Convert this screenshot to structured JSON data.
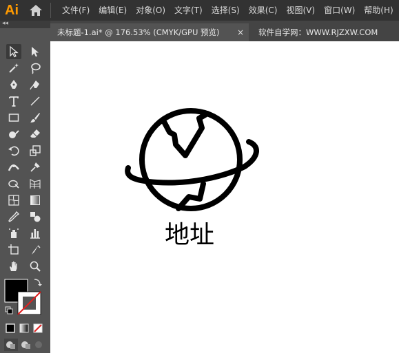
{
  "app": {
    "logo": "Ai",
    "home_icon": "home-icon"
  },
  "menu": [
    "文件(F)",
    "编辑(E)",
    "对象(O)",
    "文字(T)",
    "选择(S)",
    "效果(C)",
    "视图(V)",
    "窗口(W)",
    "帮助(H)"
  ],
  "tabs": {
    "active_title": "未标题-1.ai* @ 176.53% (CMYK/GPU 预览)",
    "close_symbol": "×",
    "other_title": "软件自学网：WWW.RJZXW.COM"
  },
  "toolbar": {
    "collapse_symbol": "◂◂",
    "tools": [
      "selection-tool",
      "direct-selection-tool",
      "magic-wand-tool",
      "lasso-tool",
      "pen-tool",
      "curvature-tool",
      "type-tool",
      "line-segment-tool",
      "rectangle-tool",
      "paintbrush-tool",
      "shaper-tool",
      "eraser-tool",
      "rotate-tool",
      "scale-tool",
      "width-tool",
      "puppet-warp-tool",
      "shape-builder-tool",
      "perspective-grid-tool",
      "mesh-tool",
      "gradient-tool",
      "eyedropper-tool",
      "blend-tool",
      "symbol-sprayer-tool",
      "column-graph-tool",
      "artboard-tool",
      "slice-tool",
      "hand-tool",
      "zoom-tool"
    ],
    "fill_color": "#000000",
    "stroke_color": "none"
  },
  "canvas": {
    "caption": "地址",
    "artwork": "globe-icon"
  }
}
